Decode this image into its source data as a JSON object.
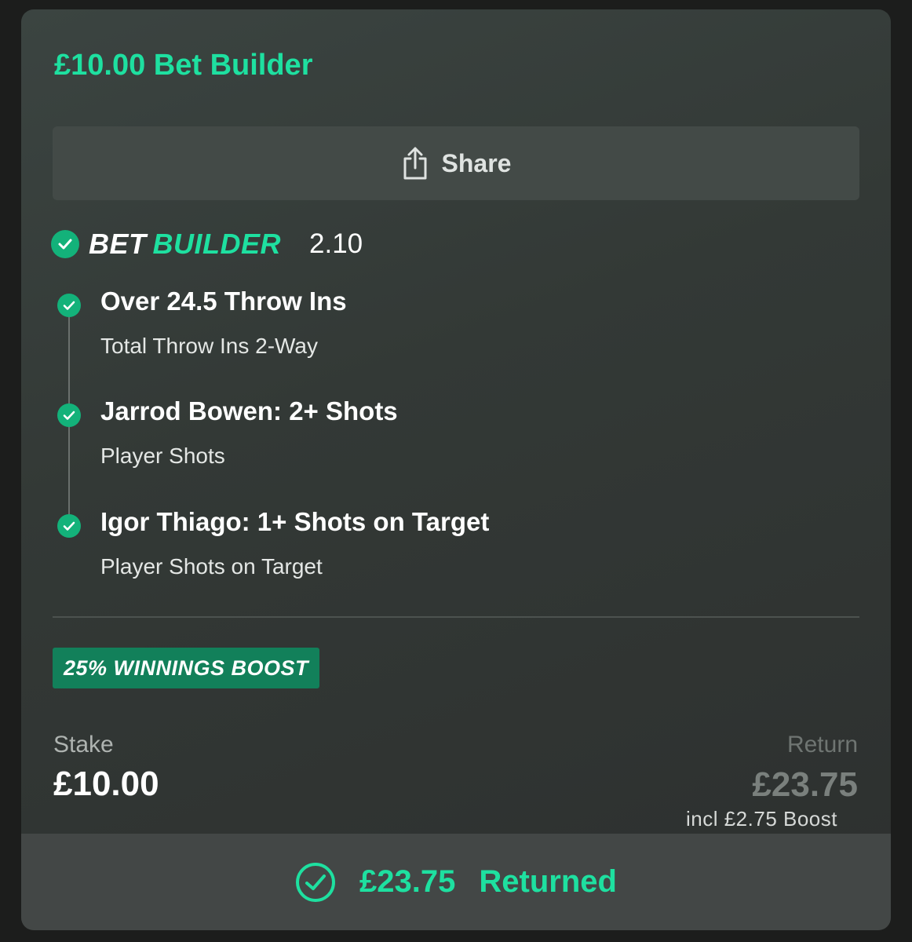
{
  "bet": {
    "title": "£10.00 Bet Builder",
    "share_label": "Share",
    "bet_builder_logo_part1": "BET",
    "bet_builder_logo_part2": "BUILDER",
    "odds": "2.10",
    "legs": [
      {
        "selection": "Over 24.5 Throw Ins",
        "market": "Total Throw Ins 2-Way",
        "status": "won"
      },
      {
        "selection": "Jarrod Bowen: 2+ Shots",
        "market": "Player Shots",
        "status": "won"
      },
      {
        "selection": "Igor Thiago: 1+ Shots on Target",
        "market": "Player Shots on Target",
        "status": "won"
      }
    ],
    "boost_badge": "25% WINNINGS BOOST",
    "stake_label": "Stake",
    "stake_value": "£10.00",
    "return_label": "Return",
    "return_value": "£23.75",
    "boost_note": "incl £2.75 Boost",
    "returned_amount": "£23.75",
    "returned_label": "Returned"
  },
  "colors": {
    "accent": "#1ee0a0",
    "check_fill": "#13b27a",
    "badge_fill": "#12805a",
    "card_bg": "#333936"
  },
  "icons": {
    "share": "share-icon",
    "leg_check": "check-circle-icon",
    "returned": "check-circle-outline-icon"
  }
}
